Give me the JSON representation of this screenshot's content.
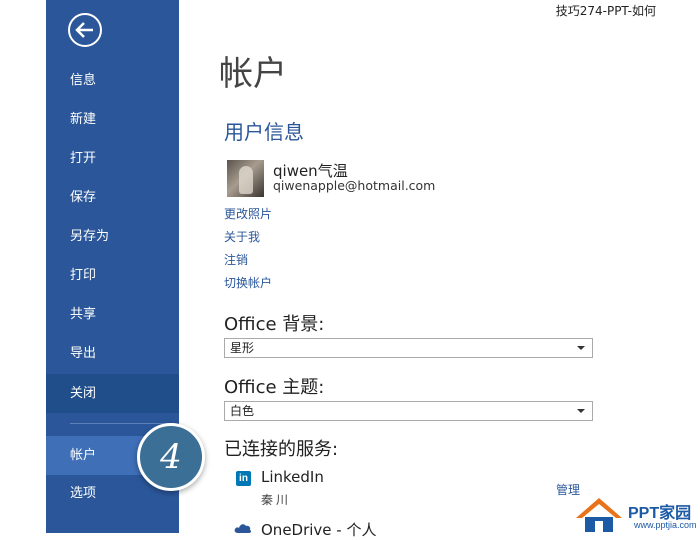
{
  "watermark": "技巧274-PPT-如何",
  "sidebar": {
    "items": [
      {
        "label": "信息"
      },
      {
        "label": "新建"
      },
      {
        "label": "打开"
      },
      {
        "label": "保存"
      },
      {
        "label": "另存为"
      },
      {
        "label": "打印"
      },
      {
        "label": "共享"
      },
      {
        "label": "导出"
      },
      {
        "label": "关闭"
      },
      {
        "label": "帐户"
      },
      {
        "label": "选项"
      }
    ],
    "step_number": "4"
  },
  "main": {
    "title": "帐户",
    "user_info_heading": "用户信息",
    "user_name": "qiwen气温",
    "user_email": "qiwenapple@hotmail.com",
    "links": [
      "更改照片",
      "关于我",
      "注销",
      "切换帐户"
    ],
    "background_label": "Office 背景:",
    "background_value": "星形",
    "theme_label": "Office 主题:",
    "theme_value": "白色",
    "connected_services_heading": "已连接的服务:",
    "services": [
      {
        "icon": "linkedin-icon",
        "name": "LinkedIn",
        "sub": "秦川",
        "action": "管理"
      },
      {
        "icon": "onedrive-icon",
        "name": "OneDrive - 个人"
      }
    ]
  },
  "logo": {
    "text": "PPT家园",
    "url": "www.pptjia.com"
  },
  "colors": {
    "sidebar": "#2b579a",
    "accent": "#2b579a"
  }
}
